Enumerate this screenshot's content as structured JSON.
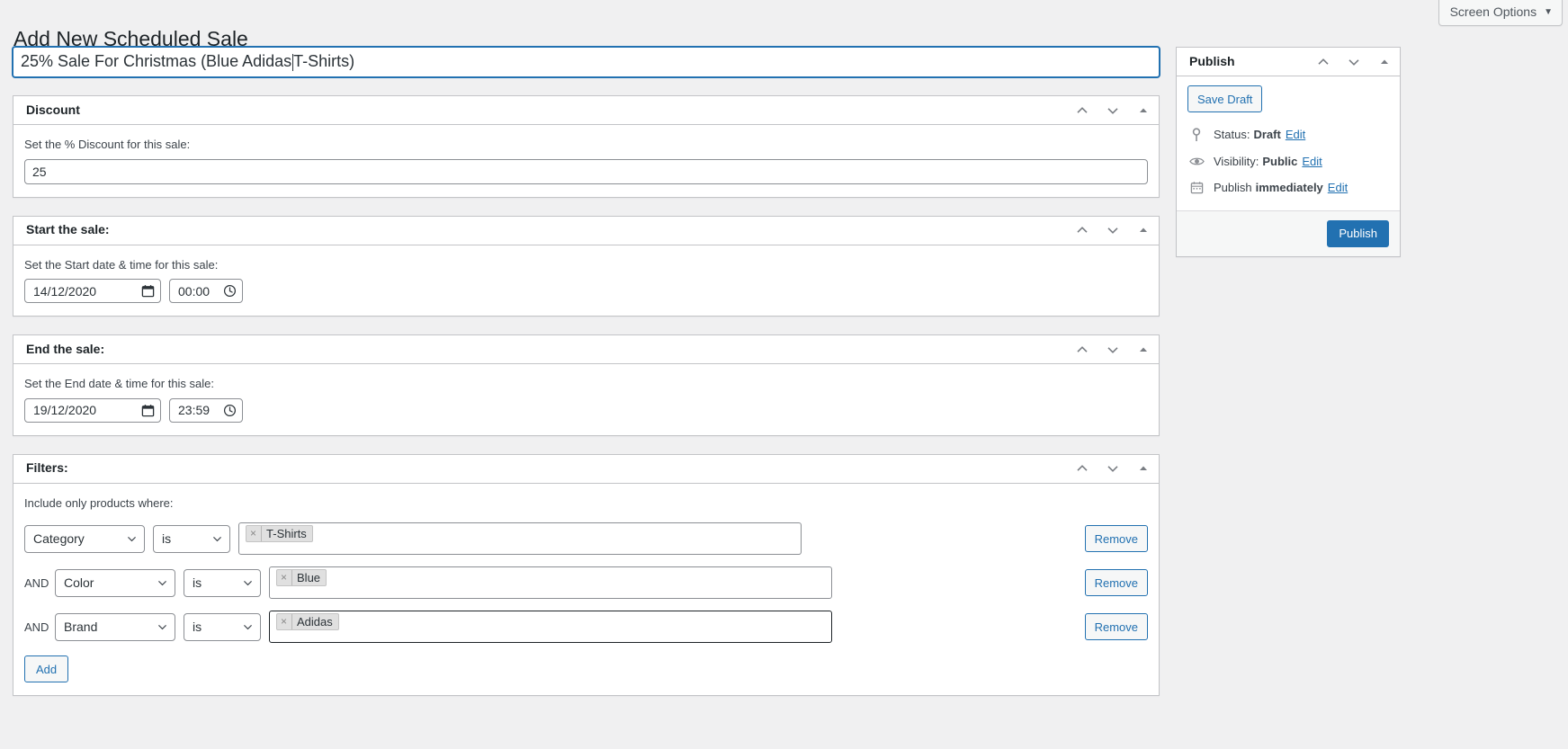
{
  "header": {
    "page_title": "Add New Scheduled Sale",
    "screen_options_label": "Screen Options",
    "screen_options_caret": "▼"
  },
  "title_field": {
    "value_before_caret": "25% Sale For Christmas (Blue Adidas ",
    "value_after_caret": "T-Shirts)"
  },
  "panels": {
    "discount": {
      "heading": "Discount",
      "label": "Set the % Discount for this sale:",
      "value": "25"
    },
    "start": {
      "heading": "Start the sale:",
      "label": "Set the Start date & time for this sale:",
      "date": "14/12/2020",
      "time": "00:00"
    },
    "end": {
      "heading": "End the sale:",
      "label": "Set the End date & time for this sale:",
      "date": "19/12/2020",
      "time": "23:59"
    },
    "filters": {
      "heading": "Filters:",
      "label": "Include only products where:",
      "and_label": "AND",
      "remove_label": "Remove",
      "add_label": "Add",
      "rows": [
        {
          "conjunction": "",
          "field": "Category",
          "operator": "is",
          "chip": "T-Shirts",
          "focused": false
        },
        {
          "conjunction": "AND",
          "field": "Color",
          "operator": "is",
          "chip": "Blue",
          "focused": false
        },
        {
          "conjunction": "AND",
          "field": "Brand",
          "operator": "is",
          "chip": "Adidas",
          "focused": true
        }
      ]
    }
  },
  "publish": {
    "heading": "Publish",
    "save_draft_label": "Save Draft",
    "publish_label": "Publish",
    "status_prefix": "Status:",
    "status_value": "Draft",
    "visibility_prefix": "Visibility:",
    "visibility_value": "Public",
    "schedule_prefix": "Publish",
    "schedule_value": "immediately",
    "edit_label": "Edit"
  },
  "icons": {
    "chip_remove": "×",
    "chevron_up": "chevron-up-icon",
    "chevron_down": "chevron-down-icon",
    "collapse": "collapse-triangle-icon"
  },
  "colors": {
    "accent": "#2271b1",
    "panel_border": "#c3c4c7",
    "page_bg": "#f0f0f1",
    "text": "#3c434a"
  }
}
